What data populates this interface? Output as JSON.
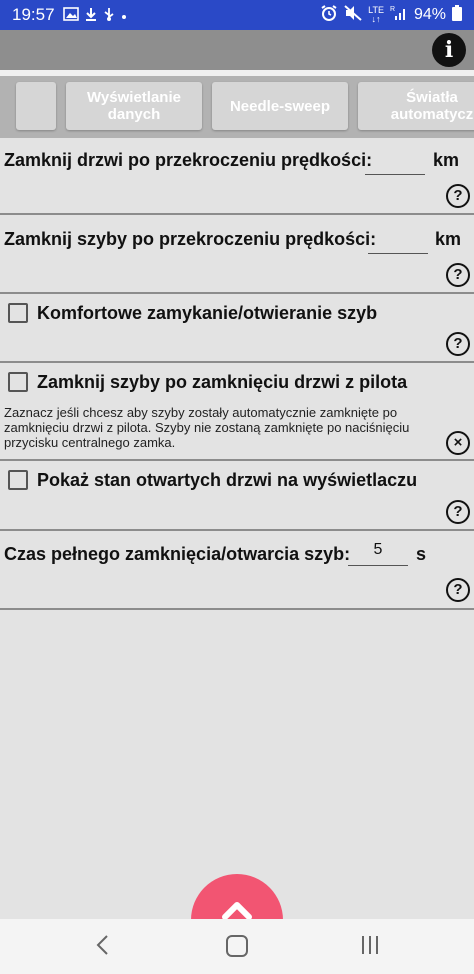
{
  "status": {
    "time": "19:57",
    "battery": "94%",
    "lte": "LTE",
    "roaming": "R"
  },
  "tabs": [
    {
      "label": ""
    },
    {
      "label": "Wyświetlanie danych"
    },
    {
      "label": "Needle-sweep"
    },
    {
      "label": "Światła automatycz"
    }
  ],
  "settings": {
    "door_lock_speed": {
      "label": "Zamknij drzwi po przekroczeniu prędkości:",
      "value": "",
      "unit": "km"
    },
    "window_lock_speed": {
      "label": "Zamknij szyby po przekroczeniu prędkości:",
      "value": "",
      "unit": "km"
    },
    "comfort_windows": {
      "label": "Komfortowe zamykanie/otwieranie szyb"
    },
    "close_windows_remote": {
      "label": "Zamknij szyby po zamknięciu drzwi z pilota",
      "description": "Zaznacz jeśli chcesz aby szyby zostały automatycznie zamknięte po zamknięciu drzwi z pilota. Szyby nie zostaną zamknięte po naciśnięciu przycisku centralnego zamka."
    },
    "show_open_doors": {
      "label": "Pokaż stan otwartych drzwi na wyświetlaczu"
    },
    "window_time": {
      "label": "Czas pełnego zamknięcia/otwarcia szyb:",
      "value": "5",
      "unit": "s"
    }
  },
  "help_glyph": "?",
  "info_glyph": "i",
  "close_glyph": "×"
}
